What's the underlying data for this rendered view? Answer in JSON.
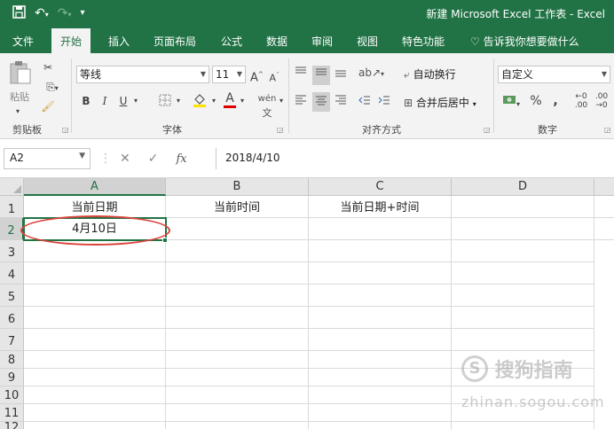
{
  "window": {
    "title": "新建 Microsoft Excel 工作表 - Excel"
  },
  "tabs": [
    {
      "label": "文件"
    },
    {
      "label": "开始"
    },
    {
      "label": "插入"
    },
    {
      "label": "页面布局"
    },
    {
      "label": "公式"
    },
    {
      "label": "数据"
    },
    {
      "label": "审阅"
    },
    {
      "label": "视图"
    },
    {
      "label": "特色功能"
    }
  ],
  "tell_me": "告诉我你想要做什么",
  "ribbon": {
    "clipboard": {
      "paste_label": "粘贴",
      "group_label": "剪贴板"
    },
    "font": {
      "font_name": "等线",
      "font_size": "11",
      "bold": "B",
      "italic": "I",
      "underline": "U",
      "group_label": "字体"
    },
    "alignment": {
      "wrap_text": "自动换行",
      "merge_center": "合并后居中",
      "group_label": "对齐方式"
    },
    "number": {
      "format": "自定义",
      "percent": "%",
      "comma": ",",
      "group_label": "数字"
    }
  },
  "formula_bar": {
    "name_box": "A2",
    "fx": "fx",
    "formula": "2018/4/10"
  },
  "sheet": {
    "columns": [
      "A",
      "B",
      "C",
      "D"
    ],
    "rows": [
      "1",
      "2",
      "3",
      "4",
      "5",
      "6",
      "7",
      "8",
      "9",
      "10",
      "11",
      "12"
    ],
    "cells": {
      "A1": "当前日期",
      "B1": "当前时间",
      "C1": "当前日期+时间",
      "A2": "4月10日"
    }
  },
  "watermark": {
    "main": "搜狗指南",
    "sub": "zhinan.sogou.com"
  }
}
